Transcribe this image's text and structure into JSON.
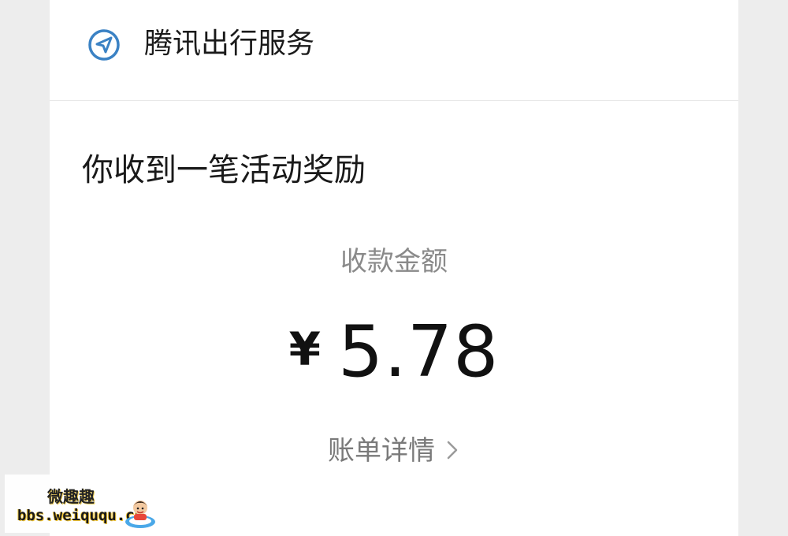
{
  "header": {
    "service_icon": "navigation-arrow-icon",
    "service_name": "腾讯出行服务"
  },
  "message": {
    "title": "你收到一笔活动奖励"
  },
  "payment": {
    "amount_label": "收款金额",
    "currency_symbol": "¥",
    "amount": "5.78"
  },
  "bill": {
    "link_label": "账单详情",
    "chevron_icon": "chevron-right-icon"
  },
  "watermark": {
    "name": "微趣趣",
    "url": "bbs.weiququ.cn",
    "mascot_icon": "mascot-icon"
  },
  "colors": {
    "background": "#ededed",
    "card": "#ffffff",
    "icon_blue": "#3b82c4",
    "text_primary": "#1a1a1a",
    "text_secondary": "#8a8a8a"
  }
}
